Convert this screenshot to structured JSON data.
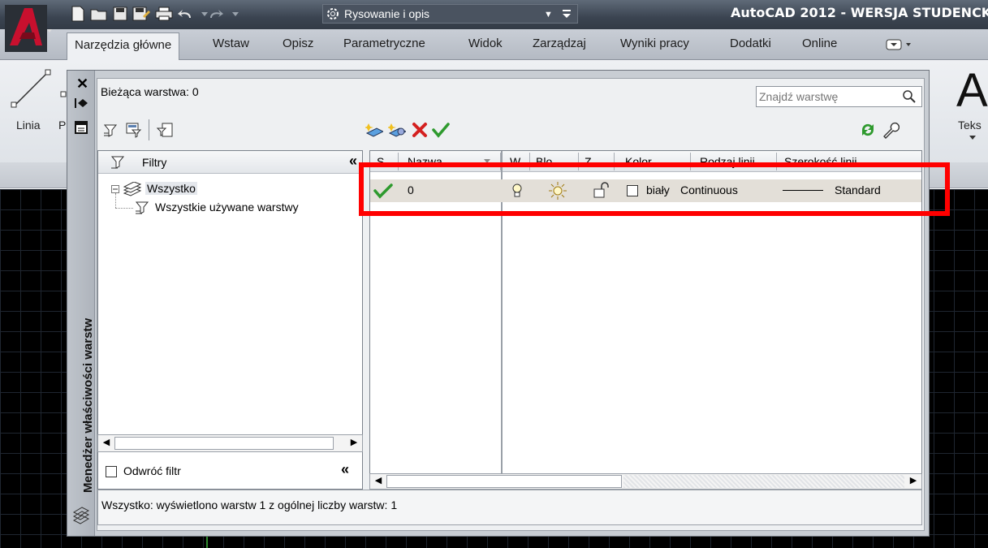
{
  "title_bar": {
    "workspace": "Rysowanie i opis",
    "app_title": "AutoCAD 2012 - WERSJA STUDENCK"
  },
  "ribbon": {
    "tabs": [
      "Narzędzia główne",
      "Wstaw",
      "Opisz",
      "Parametryczne",
      "Widok",
      "Zarządzaj",
      "Wyniki pracy",
      "Dodatki",
      "Online"
    ],
    "active_tab": "Narzędzia główne",
    "line_tool_label": "Linia",
    "partial_label": "P",
    "text_tool_label": "Teks",
    "text_tool_glyph": "A"
  },
  "layer_manager": {
    "vertical_title": "Menedżer właściwości warstw",
    "current_layer": "Bieżąca warstwa: 0",
    "search_placeholder": "Znajdź warstwę",
    "filters_header": "Filtry",
    "tree": {
      "root": "Wszystko",
      "child": "Wszystkie używane warstwy"
    },
    "invert_filter_label": "Odwróć filtr",
    "collapse_glyph": "«",
    "columns": [
      "S...",
      "Nazwa",
      "W.",
      "Blo...",
      "Z...",
      "Kolor",
      "Rodzaj linii",
      "Szerokość linii"
    ],
    "layer": {
      "name": "0",
      "color": "biały",
      "linetype": "Continuous",
      "lineweight": "Standard"
    },
    "status": "Wszystko: wyświetlono warstw 1 z ogólnej liczby warstw: 1"
  },
  "colors": {
    "highlight": "#ff0000",
    "autocad_red": "#c8102e",
    "check_green": "#2e9a2e"
  }
}
